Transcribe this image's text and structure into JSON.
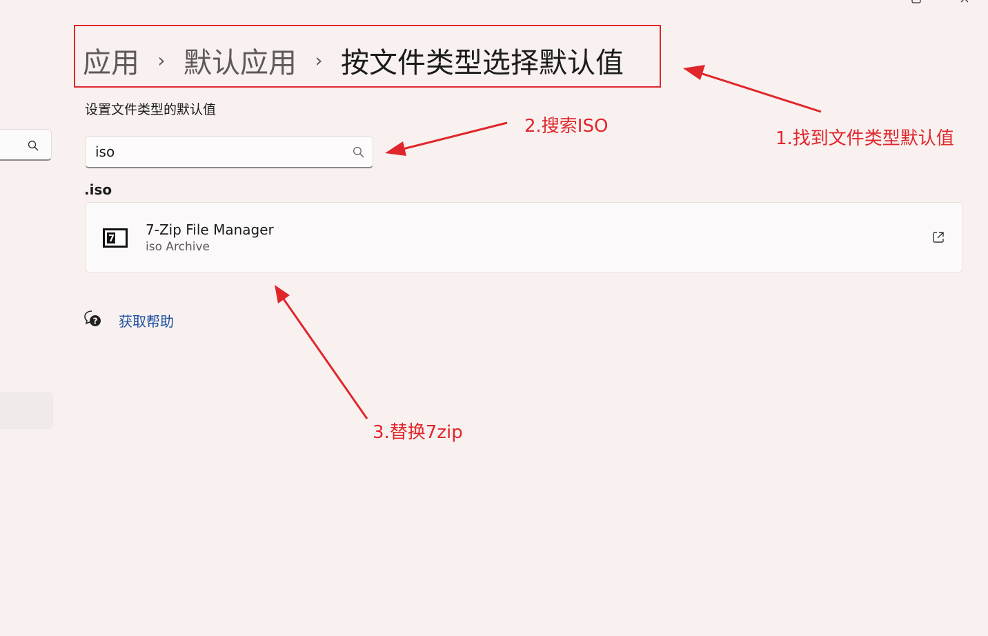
{
  "breadcrumb": {
    "items": [
      "应用",
      "默认应用"
    ],
    "current": "按文件类型选择默认值",
    "separator": "›"
  },
  "section_title": "设置文件类型的默认值",
  "search": {
    "value": "iso",
    "icon": "search-icon"
  },
  "results": {
    "extension": ".iso",
    "app": {
      "name": "7-Zip File Manager",
      "subtitle": "iso Archive",
      "icon": "7zip-icon",
      "icon_text": "7z",
      "action_icon": "open-external-icon"
    }
  },
  "help": {
    "label": "获取帮助",
    "icon": "help-chat-icon"
  },
  "annotations": {
    "step1": "1.找到文件类型默认值",
    "step2": "2.搜索ISO",
    "step3": "3.替换7zip",
    "color": "#e0262b"
  },
  "colors": {
    "background": "#f8f1f0",
    "accent_link": "#1c4fa0",
    "annotation_red": "#e0262b"
  }
}
